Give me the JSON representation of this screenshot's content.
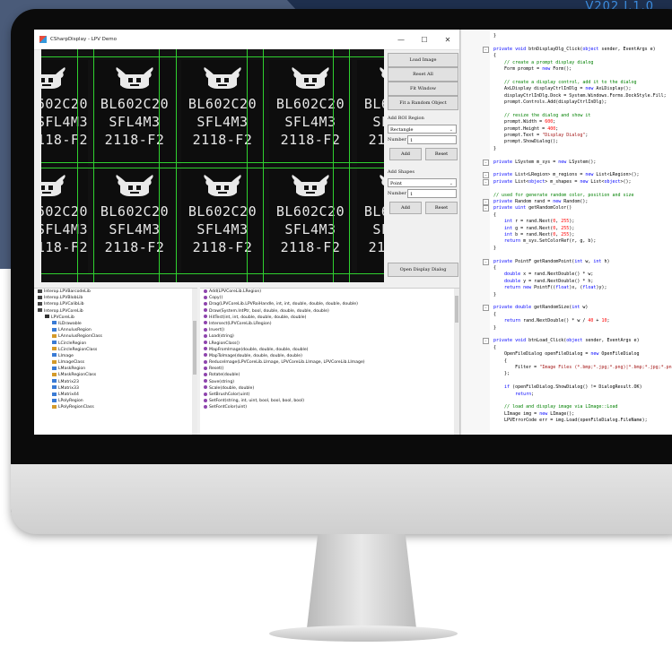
{
  "version_text": "V202 I.1.0",
  "window": {
    "title": "CSharpDisplay - LPV Demo",
    "minimize": "—",
    "maximize": "☐",
    "close": "✕"
  },
  "chip_text": {
    "line1": "BL602C20",
    "line2": "SFL4M3",
    "line3": "2118-F2",
    "line1_edge_left": "L602C20",
    "line2_edge_left": "SFL4M3",
    "line3_edge_left": "118-F2"
  },
  "panel": {
    "load_image": "Load Image",
    "reset_all": "Reset All",
    "fit_window": "Fit Window",
    "fit_random_object": "Fit a Random Object",
    "add_roi_region_label": "Add ROI Region",
    "roi_shape_value": "Rectangle",
    "roi_number_label": "Number",
    "roi_number_value": "1",
    "roi_add": "Add",
    "roi_reset": "Reset",
    "add_shapes_label": "Add Shapes",
    "shape_value": "Point",
    "shape_number_label": "Number",
    "shape_number_value": "1",
    "shape_add": "Add",
    "shape_reset": "Reset",
    "open_display_dialog": "Open Display Dialog"
  },
  "tree": [
    {
      "label": "Interop.LPVBarcodeLib",
      "indent": 0,
      "icon": "namespace-icon"
    },
    {
      "label": "Interop.LPVBlobLib",
      "indent": 0,
      "icon": "namespace-icon"
    },
    {
      "label": "Interop.LPVCalibLib",
      "indent": 0,
      "icon": "namespace-icon"
    },
    {
      "label": "Interop.LPVCoreLib",
      "indent": 0,
      "icon": "namespace-icon"
    },
    {
      "label": "LPVCoreLib",
      "indent": 1,
      "icon": "braces-icon"
    },
    {
      "label": "ILDrawable",
      "indent": 2,
      "icon": "interface-icon"
    },
    {
      "label": "LAnnulusRegion",
      "indent": 2,
      "icon": "interface-icon"
    },
    {
      "label": "LAnnulusRegionClass",
      "indent": 2,
      "icon": "class-icon"
    },
    {
      "label": "LCircleRegion",
      "indent": 2,
      "icon": "interface-icon"
    },
    {
      "label": "LCircleRegionClass",
      "indent": 2,
      "icon": "class-icon"
    },
    {
      "label": "LImage",
      "indent": 2,
      "icon": "interface-icon"
    },
    {
      "label": "LImageClass",
      "indent": 2,
      "icon": "class-icon"
    },
    {
      "label": "LMaskRegion",
      "indent": 2,
      "icon": "interface-icon"
    },
    {
      "label": "LMaskRegionClass",
      "indent": 2,
      "icon": "class-icon"
    },
    {
      "label": "LMatrix23",
      "indent": 2,
      "icon": "struct-icon"
    },
    {
      "label": "LMatrix33",
      "indent": 2,
      "icon": "struct-icon"
    },
    {
      "label": "LMatrix44",
      "indent": 2,
      "icon": "struct-icon"
    },
    {
      "label": "LPolyRegion",
      "indent": 2,
      "icon": "interface-icon"
    },
    {
      "label": "LPolyRegionClass",
      "indent": 2,
      "icon": "class-icon"
    }
  ],
  "members": [
    "Add(LPVCoreLib.LRegion)",
    "Copy()",
    "Drag(LPVCoreLib.LPVRoiHandle, int, int, double, double, double, double)",
    "Draw(System.IntPtr, bool, double, double, double, double)",
    "HitTest(int, int, double, double, double, double)",
    "Intersect(LPVCoreLib.LRegion)",
    "Invert()",
    "Load(string)",
    "LRegionClass()",
    "MapFromImage(double, double, double, double)",
    "MapToImage(double, double, double, double)",
    "ReduceImage(LPVCoreLib.LImage, LPVCoreLib.LImage, LPVCoreLib.LImage)",
    "Reset()",
    "Rotate(double)",
    "Save(string)",
    "Scale(double, double)",
    "SetBrushColor(uint)",
    "SetFont(string, int, uint, bool, bool, bool, bool)",
    "SetFontColor(uint)"
  ],
  "code_lines": [
    "}",
    "",
    "private void btnDisplayDlg_Click(object sender, EventArgs e)",
    "{",
    "    // create a prompt display dialog",
    "    Form prompt = new Form();",
    "",
    "    // create a display control, add it to the dialog",
    "    AxLDisplay displayCtrlInDlg = new AxLDisplay();",
    "    displayCtrlInDlg.Dock = System.Windows.Forms.DockStyle.Fill;",
    "    prompt.Controls.Add(displayCtrlInDlg);",
    "",
    "    // resize the dialog and show it",
    "    prompt.Width = 600;",
    "    prompt.Height = 400;",
    "    prompt.Text = \"Display Dialog\";",
    "    prompt.ShowDialog();",
    "}",
    "",
    "private LSystem m_sys = new LSystem();",
    "",
    "private List<LRegion> m_regions = new List<LRegion>();",
    "private List<object> m_shapes = new List<object>();",
    "",
    "// used for generate random color, position and size",
    "private Random rand = new Random();",
    "private uint getRandomColor()",
    "{",
    "    int r = rand.Next(0, 255);",
    "    int g = rand.Next(0, 255);",
    "    int b = rand.Next(0, 255);",
    "    return m_sys.SetColorRef(r, g, b);",
    "}",
    "",
    "private PointF getRandomPoint(int w, int h)",
    "{",
    "    double x = rand.NextDouble() * w;",
    "    double y = rand.NextDouble() * h;",
    "    return new PointF((float)x, (float)y);",
    "}",
    "",
    "private double getRandomSize(int w)",
    "{",
    "    return rand.NextDouble() * w / 40 + 10;",
    "}",
    "",
    "private void btnLoad_Click(object sender, EventArgs e)",
    "{",
    "    OpenFileDialog openFileDialog = new OpenFileDialog",
    "    {",
    "        Filter = \"Image Files (*.bmp;*.jpg;*.png)|*.bmp;*.jpg;*.png\"",
    "    };",
    "",
    "    if (openFileDialog.ShowDialog() != DialogResult.OK)",
    "        return;",
    "",
    "    // load and display image via LImage::Load",
    "    LImage img = new LImage();",
    "    LPVErrorCode err = img.Load(openFileDialog.FileName);"
  ],
  "colors": {
    "keyword": "#0000ff",
    "comment": "#008000",
    "string": "#a31515",
    "number": "#ff0000",
    "roi_outline": "#2fd02f",
    "backdrop": "#4a5b79"
  }
}
